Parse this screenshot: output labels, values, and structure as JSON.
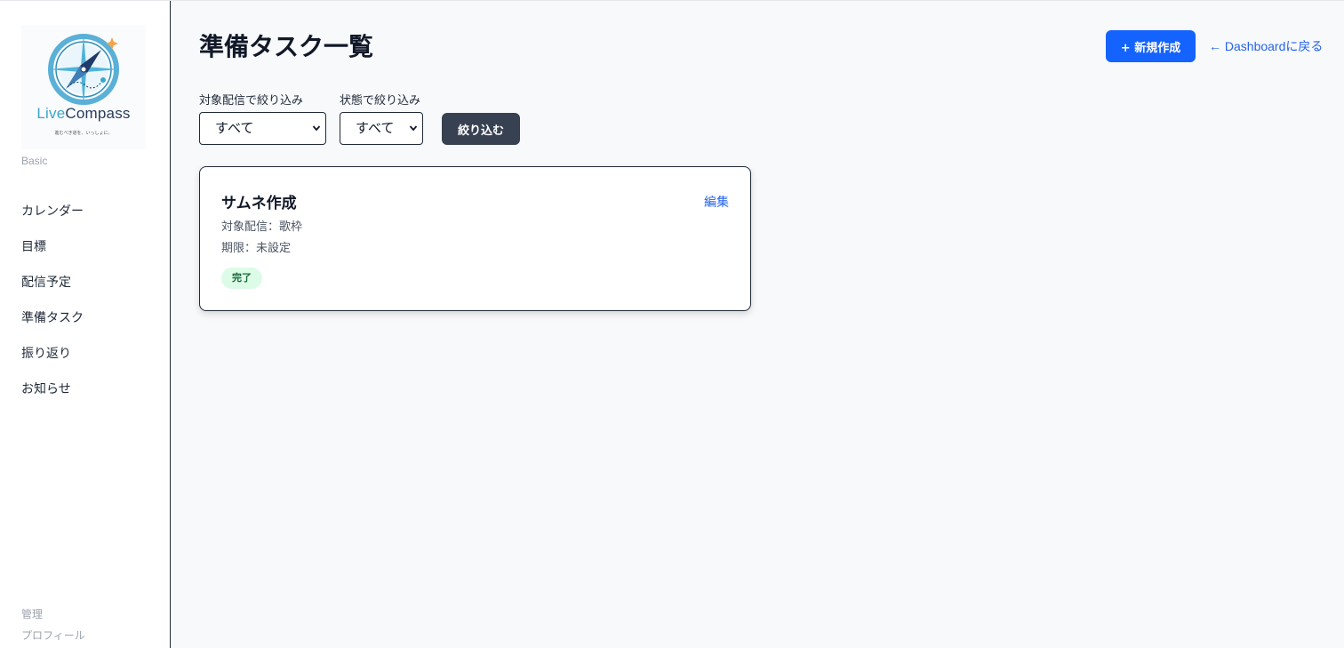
{
  "sidebar": {
    "logo": {
      "brand_live": "Live",
      "brand_compass": "Compass",
      "tagline": "進むべき道を、いっしょに。"
    },
    "plan": "Basic",
    "items": [
      {
        "label": "カレンダー"
      },
      {
        "label": "目標"
      },
      {
        "label": "配信予定"
      },
      {
        "label": "準備タスク"
      },
      {
        "label": "振り返り"
      },
      {
        "label": "お知らせ"
      }
    ],
    "bottom": {
      "admin": "管理",
      "profile": "プロフィール"
    }
  },
  "header": {
    "title": "準備タスク一覧",
    "new_button": "+ 新規作成",
    "back_link": "← Dashboardに戻る"
  },
  "filters": {
    "stream_label": "対象配信で絞り込み",
    "stream_value": "すべて",
    "status_label": "状態で絞り込み",
    "status_value": "すべて",
    "submit": "絞り込む"
  },
  "tasks": [
    {
      "title": "サムネ作成",
      "edit": "編集",
      "stream": "対象配信：歌枠",
      "deadline": "期限：未設定",
      "status": "完了"
    }
  ],
  "colors": {
    "primary": "#1463ff",
    "dark_button": "#374151",
    "link": "#2563eb",
    "badge_bg": "#dcfce7",
    "badge_text": "#166534"
  }
}
